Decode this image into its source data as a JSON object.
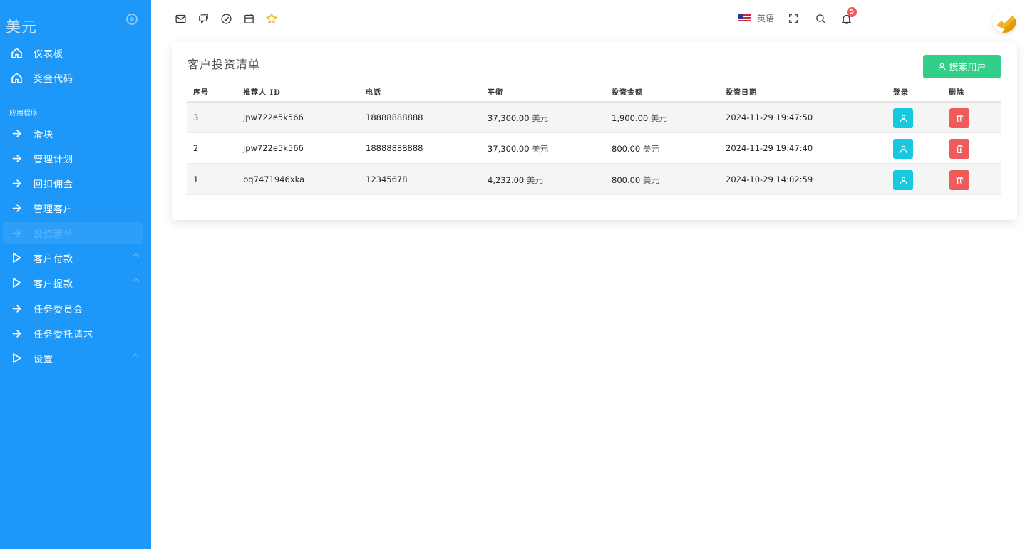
{
  "sidebar": {
    "brand": "美元",
    "section_label": "应用程序",
    "items": [
      {
        "label": "仪表板",
        "icon": "home-icon"
      },
      {
        "label": "奖金代码",
        "icon": "home-icon"
      },
      {
        "label": "滑块",
        "icon": "arrow-right-icon"
      },
      {
        "label": "管理计划",
        "icon": "arrow-right-icon"
      },
      {
        "label": "回扣佣金",
        "icon": "arrow-right-icon"
      },
      {
        "label": "管理客户",
        "icon": "arrow-right-icon"
      },
      {
        "label": "投资清单",
        "icon": "arrow-right-icon",
        "active": true
      },
      {
        "label": "客户付款",
        "icon": "play-icon",
        "expandable": true
      },
      {
        "label": "客户提款",
        "icon": "play-icon",
        "expandable": true
      },
      {
        "label": "任务委员会",
        "icon": "arrow-right-icon"
      },
      {
        "label": "任务委托请求",
        "icon": "arrow-right-icon"
      },
      {
        "label": "设置",
        "icon": "play-icon",
        "expandable": true
      }
    ]
  },
  "topbar": {
    "left_icons": [
      "mail-icon",
      "chat-icon",
      "check-circle-icon",
      "calendar-icon",
      "star-icon"
    ],
    "language": "英语",
    "notification_count": "5"
  },
  "card": {
    "title": "客户投资清单",
    "search_button": "搜索用户",
    "columns": [
      "序号",
      "推荐人 ID",
      "电话",
      "平衡",
      "投资金额",
      "投资日期",
      "登录",
      "删除"
    ],
    "currency": "美元",
    "rows": [
      {
        "no": "3",
        "referrer": "jpw722e5k566",
        "phone": "18888888888",
        "balance": "37,300.00",
        "amount": "1,900.00",
        "date": "2024-11-29 19:47:50"
      },
      {
        "no": "2",
        "referrer": "jpw722e5k566",
        "phone": "18888888888",
        "balance": "37,300.00",
        "amount": "800.00",
        "date": "2024-11-29 19:47:40"
      },
      {
        "no": "1",
        "referrer": "bq7471946xka",
        "phone": "12345678",
        "balance": "4,232.00",
        "amount": "800.00",
        "date": "2024-10-29 14:02:59"
      }
    ]
  },
  "colors": {
    "sidebar": "#1e98f8",
    "primary_green": "#32cf88",
    "login_cyan": "#17c9de",
    "danger_red": "#f15a5a",
    "star_yellow": "#f5b301"
  }
}
